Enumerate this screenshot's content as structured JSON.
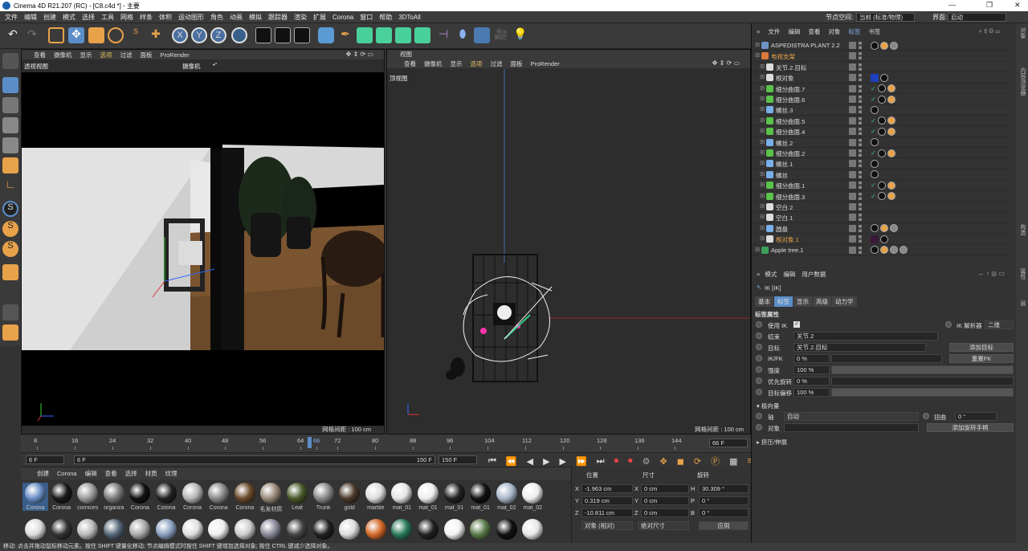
{
  "window": {
    "title": "Cinema 4D R21.207 (RC) - [C8.c4d *] - 主要"
  },
  "menu": [
    "文件",
    "编辑",
    "创建",
    "模式",
    "选择",
    "工具",
    "网格",
    "样条",
    "体积",
    "运动图形",
    "角色",
    "动画",
    "模拟",
    "跟踪器",
    "渲染",
    "扩展",
    "Corona",
    "窗口",
    "帮助",
    "3DToAll"
  ],
  "node_space": {
    "label": "节点空间:",
    "value": "当前 (标准/物理)"
  },
  "layout": {
    "label": "界面:",
    "value": "启动"
  },
  "viewport_left": {
    "menu": [
      "查看",
      "摄像机",
      "显示",
      "选项",
      "过滤",
      "面板",
      "ProRender"
    ],
    "name": "透视视图",
    "camera": "摄像机",
    "grid": "网格间距 : 100 cm"
  },
  "viewport_right": {
    "title": "视图",
    "menu": [
      "查看",
      "摄像机",
      "显示",
      "选项",
      "过滤",
      "面板",
      "ProRender"
    ],
    "name": "顶视图",
    "grid": "网格间距 : 100 cm"
  },
  "timeline": {
    "ticks": [
      "8",
      "16",
      "24",
      "32",
      "40",
      "48",
      "56",
      "64",
      "66",
      "72",
      "80",
      "88",
      "96",
      "104",
      "112",
      "120",
      "128",
      "136",
      "144"
    ],
    "current": "66 F"
  },
  "transport": {
    "start": "6 F",
    "start2": "6 F",
    "end": "150 F",
    "end2": "150 F"
  },
  "materials": {
    "tabs": [
      "创建",
      "Corona",
      "编辑",
      "查看",
      "选择",
      "材质",
      "纹理"
    ],
    "row1": [
      {
        "name": "Corona",
        "color": "#6a8fc5"
      },
      {
        "name": "Corona",
        "color": "#1a1a1a"
      },
      {
        "name": "cornices",
        "color": "#9a9a9a"
      },
      {
        "name": "organza",
        "color": "#7a7a7a"
      },
      {
        "name": "Corona",
        "color": "#111111"
      },
      {
        "name": "Corona",
        "color": "#222222"
      },
      {
        "name": "Corona",
        "color": "#b5b5b5"
      },
      {
        "name": "Corona",
        "color": "#8a8a8a"
      },
      {
        "name": "Corona",
        "color": "#6b4a2a"
      },
      {
        "name": "毛发材质",
        "color": "#9a8a7a"
      },
      {
        "name": "Leaf",
        "color": "#4a5a2a"
      },
      {
        "name": "Trunk",
        "color": "#8a8a8a"
      },
      {
        "name": "gold",
        "color": "#4a3a2a"
      },
      {
        "name": "marble",
        "color": "#dddddd"
      },
      {
        "name": "mat_01",
        "color": "#e5e5e5"
      },
      {
        "name": "mat_01",
        "color": "#eeeeee"
      },
      {
        "name": "mat_01",
        "color": "#222222"
      },
      {
        "name": "mat_01",
        "color": "#111111"
      },
      {
        "name": "mat_02",
        "color": "#a8b8c8"
      },
      {
        "name": "mat_02",
        "color": "#eeeeee"
      }
    ],
    "row2": [
      "#dddddd",
      "#333333",
      "#bbbbbb",
      "#556677",
      "#aaaaaa",
      "#8aa0c0",
      "#e0e0e0",
      "#eeeeee",
      "#cccccc",
      "#888899",
      "#444444",
      "#222222",
      "#dddddd",
      "#d46a2a",
      "#2a7a5a",
      "#222222",
      "#f2f2f2",
      "#5a7a4a",
      "#111111",
      "#e8e8e8"
    ]
  },
  "coords": {
    "headers": [
      "位置",
      "尺寸",
      "旋转"
    ],
    "x": "-1.963 cm",
    "y": "0.319 cm",
    "z": "-10.811 cm",
    "sx": "0 cm",
    "sy": "0 cm",
    "sz": "0 cm",
    "h": "30.309 °",
    "p": "0 °",
    "b": "0 °",
    "mode1": "对象 (相对)",
    "mode2": "绝对尺寸",
    "apply": "应用"
  },
  "status": "移动: 点击并拖动鼠标移动元素。按住 SHIFT 键量化移动; 节点编辑模式时按住 SHIFT 键增加选择对象; 按住 CTRL 键减少选择对象。",
  "objects": {
    "menu": [
      "文件",
      "编辑",
      "查看",
      "对象",
      "标签",
      "书签"
    ],
    "rows": [
      {
        "name": "ASPEDISTRA PLANT 2.2",
        "icon": "#6d94c8",
        "indent": 0,
        "tags": 3
      },
      {
        "name": "电视支架",
        "icon": "#d97a3a",
        "indent": 0,
        "tags": 0,
        "orange": true
      },
      {
        "name": "关节.2.目标",
        "icon": "#dddddd",
        "indent": 1,
        "tags": 0
      },
      {
        "name": "根对象",
        "icon": "#dddddd",
        "indent": 1,
        "tags": 1,
        "mat": "#1f3fbf"
      },
      {
        "name": "细分曲面.7",
        "icon": "#5ac24a",
        "indent": 1,
        "tags": 2
      },
      {
        "name": "细分曲面.6",
        "icon": "#5ac24a",
        "indent": 1,
        "tags": 2
      },
      {
        "name": "螺丝.3",
        "icon": "#7ab0e8",
        "indent": 1,
        "tags": 1
      },
      {
        "name": "细分曲面.5",
        "icon": "#5ac24a",
        "indent": 1,
        "tags": 2
      },
      {
        "name": "细分曲面.4",
        "icon": "#5ac24a",
        "indent": 1,
        "tags": 2
      },
      {
        "name": "螺丝.2",
        "icon": "#7ab0e8",
        "indent": 1,
        "tags": 1
      },
      {
        "name": "细分曲面.2",
        "icon": "#5ac24a",
        "indent": 1,
        "tags": 2
      },
      {
        "name": "螺丝.1",
        "icon": "#7ab0e8",
        "indent": 1,
        "tags": 1
      },
      {
        "name": "螺丝",
        "icon": "#7ab0e8",
        "indent": 1,
        "tags": 1
      },
      {
        "name": "细分曲面.1",
        "icon": "#5ac24a",
        "indent": 1,
        "tags": 2
      },
      {
        "name": "细分曲面.3",
        "icon": "#5ac24a",
        "indent": 1,
        "tags": 2
      },
      {
        "name": "空白.2",
        "icon": "#dddddd",
        "indent": 1,
        "tags": 0
      },
      {
        "name": "空白.1",
        "icon": "#dddddd",
        "indent": 1,
        "tags": 0
      },
      {
        "name": "圆盘",
        "icon": "#7ab0e8",
        "indent": 1,
        "tags": 3
      },
      {
        "name": "根对象.1",
        "icon": "#dddddd",
        "indent": 1,
        "tags": 1,
        "orange": true,
        "mat": "#3a1a3a"
      },
      {
        "name": "Apple tree.1",
        "icon": "#3aa05a",
        "indent": 0,
        "tags": 4
      }
    ]
  },
  "attributes": {
    "menu": [
      "模式",
      "编辑",
      "用户数据"
    ],
    "title": "IK [IK]",
    "tabs": [
      "基本",
      "标签",
      "显示",
      "高级",
      "动力学"
    ],
    "section": "标签属性",
    "use_ik": "使用 IK",
    "solver_label": "IK 解析器",
    "solver": "二维",
    "end_label": "结束",
    "end": "关节.2",
    "target_label": "目标",
    "target": "关节.2.目标",
    "add_target": "添加目标",
    "ikfk_label": "IK/FK",
    "ikfk": "0 %",
    "reset_fk": "重置FK",
    "strength_label": "强度",
    "strength": "100 %",
    "priority_label": "优先旋转",
    "priority": "0 %",
    "target_offset_label": "目标偏移",
    "target_offset": "100 %",
    "pole": "极向量",
    "axis_label": "轴",
    "axis": "自动",
    "twist_label": "扭曲",
    "twist": "0 °",
    "object_label": "对象",
    "add_rot": "添加旋转手柄",
    "stretch": "挤压/伸展"
  },
  "right_strip": [
    "对象",
    "内容浏览器",
    "构造",
    "属性",
    "层"
  ]
}
